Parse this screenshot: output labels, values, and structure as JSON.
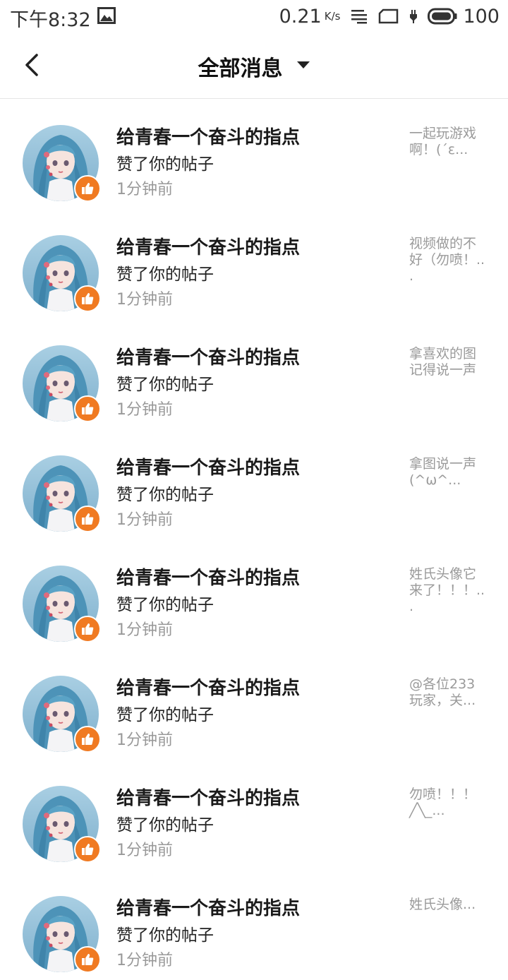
{
  "status_bar": {
    "time": "下午8:32",
    "net_speed": "0.21",
    "net_unit": "K/s",
    "battery": "100"
  },
  "header": {
    "title": "全部消息"
  },
  "messages": [
    {
      "name": "给青春一个奋斗的指点",
      "action": "赞了你的帖子",
      "time": "1分钟前",
      "preview": "一起玩游戏啊！(´ε..."
    },
    {
      "name": "给青春一个奋斗的指点",
      "action": "赞了你的帖子",
      "time": "1分钟前",
      "preview": "视频做的不好（勿喷！.. ."
    },
    {
      "name": "给青春一个奋斗的指点",
      "action": "赞了你的帖子",
      "time": "1分钟前",
      "preview": "拿喜欢的图记得说一声"
    },
    {
      "name": "给青春一个奋斗的指点",
      "action": "赞了你的帖子",
      "time": "1分钟前",
      "preview": "拿图说一声(^ω^..."
    },
    {
      "name": "给青春一个奋斗的指点",
      "action": "赞了你的帖子",
      "time": "1分钟前",
      "preview": "姓氏头像它来了！！！.. ."
    },
    {
      "name": "给青春一个奋斗的指点",
      "action": "赞了你的帖子",
      "time": "1分钟前",
      "preview": "@各位233玩家，关..."
    },
    {
      "name": "给青春一个奋斗的指点",
      "action": "赞了你的帖子",
      "time": "1分钟前",
      "preview": "勿喷！！！ ╱╲_..."
    },
    {
      "name": "给青春一个奋斗的指点",
      "action": "赞了你的帖子",
      "time": "1分钟前",
      "preview": "姓氏头像..."
    }
  ],
  "colors": {
    "like_badge": "#f07a22",
    "time_text": "#999999",
    "preview_text": "#9a9a9a"
  },
  "icons": [
    "image-icon",
    "menu-lines-icon",
    "sim-card-icon",
    "charging-icon",
    "battery-icon",
    "back-arrow-icon",
    "caret-down-icon",
    "thumbs-up-icon"
  ]
}
